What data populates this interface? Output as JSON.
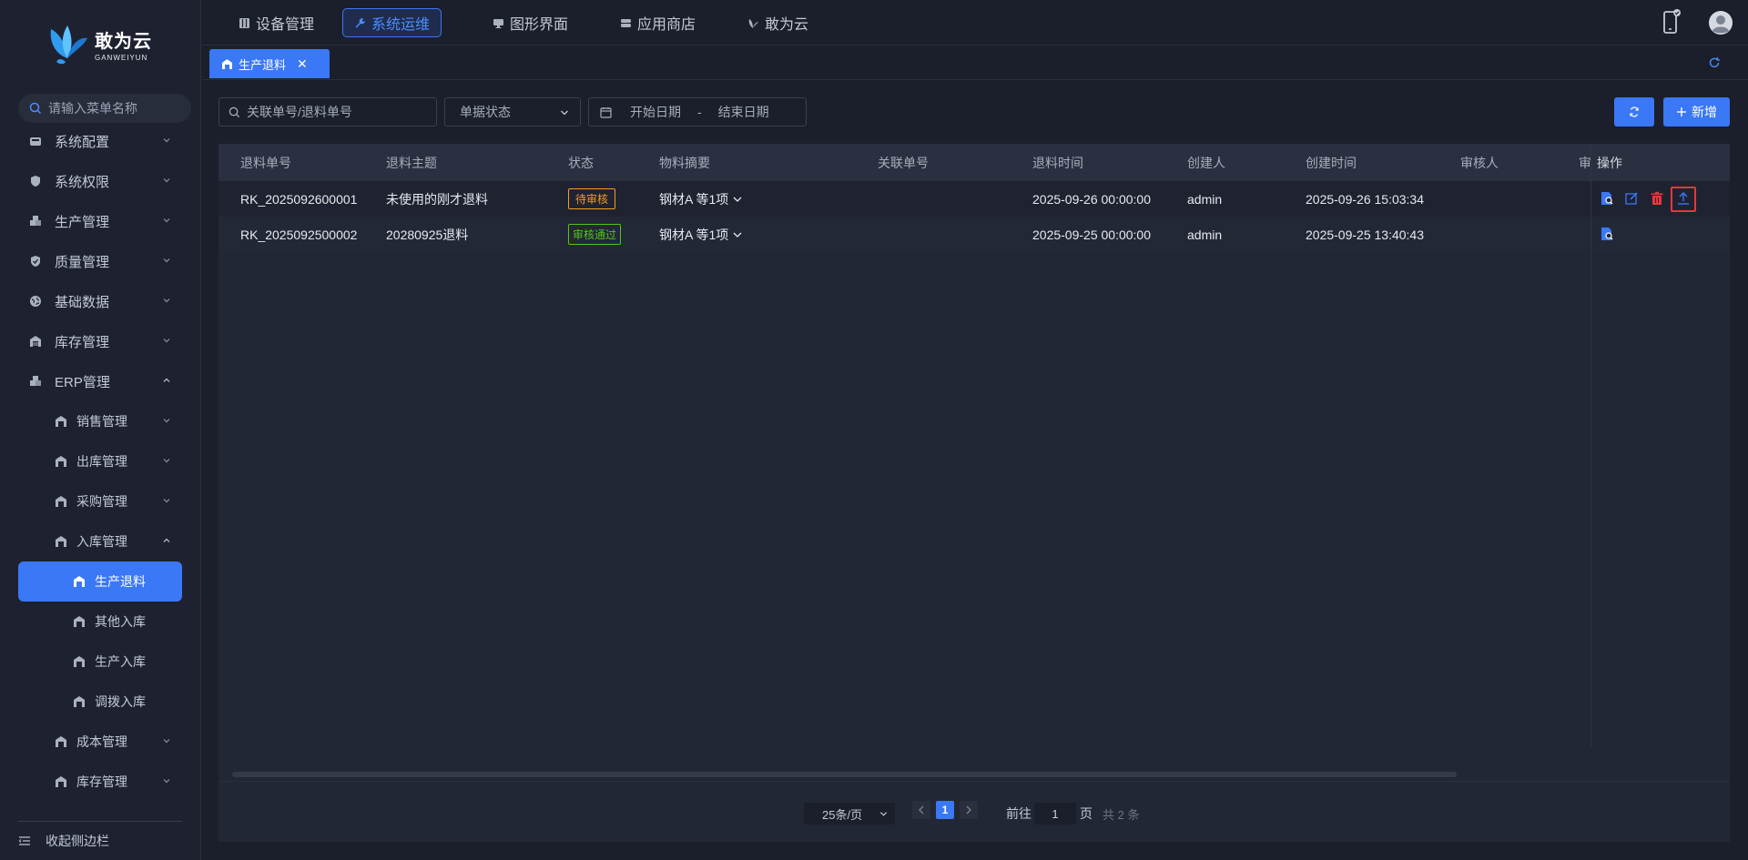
{
  "brand": {
    "name_cn": "敢为云",
    "name_en": "GANWEIYUN"
  },
  "sidebar": {
    "search_placeholder": "请输入菜单名称",
    "items": [
      {
        "label": "系统配置"
      },
      {
        "label": "系统权限"
      },
      {
        "label": "生产管理"
      },
      {
        "label": "质量管理"
      },
      {
        "label": "基础数据"
      },
      {
        "label": "库存管理"
      },
      {
        "label": "ERP管理"
      }
    ],
    "erp_children": [
      {
        "label": "销售管理"
      },
      {
        "label": "出库管理"
      },
      {
        "label": "采购管理"
      },
      {
        "label": "入库管理"
      },
      {
        "label": "成本管理"
      },
      {
        "label": "库存管理"
      }
    ],
    "inbound_children": [
      {
        "label": "生产退料",
        "active": true
      },
      {
        "label": "其他入库"
      },
      {
        "label": "生产入库"
      },
      {
        "label": "调拨入库"
      }
    ],
    "collapse_label": "收起侧边栏"
  },
  "topnav": {
    "tabs": [
      {
        "label": "设备管理",
        "icon": "device-icon"
      },
      {
        "label": "系统运维",
        "icon": "wrench-icon",
        "active": true
      },
      {
        "label": "图形界面",
        "icon": "monitor-icon"
      },
      {
        "label": "应用商店",
        "icon": "store-icon"
      },
      {
        "label": "敢为云",
        "icon": "cloud-logo-icon"
      }
    ]
  },
  "page_tab": {
    "label": "生产退料"
  },
  "filters": {
    "search_placeholder": "关联单号/退料单号",
    "status_placeholder": "单据状态",
    "start_date_placeholder": "开始日期",
    "date_separator": "-",
    "end_date_placeholder": "结束日期",
    "add_label": "新增"
  },
  "table": {
    "columns": [
      "退料单号",
      "退料主题",
      "状态",
      "物料摘要",
      "关联单号",
      "退料时间",
      "创建人",
      "创建时间",
      "审核人",
      "审",
      "操作"
    ],
    "rows": [
      {
        "code": "RK_2025092600001",
        "subject": "未使用的刚才退料",
        "status": "待审核",
        "summary": "钢材A 等1项",
        "related": "",
        "return_time": "2025-09-26 00:00:00",
        "creator": "admin",
        "created_at": "2025-09-26 15:03:34",
        "auditor": ""
      },
      {
        "code": "RK_2025092500002",
        "subject": "20280925退料",
        "status": "审核通过",
        "summary": "钢材A 等1项",
        "related": "",
        "return_time": "2025-09-25 00:00:00",
        "creator": "admin",
        "created_at": "2025-09-25 13:40:43",
        "auditor": ""
      }
    ]
  },
  "pagination": {
    "page_size_label": "25条/页",
    "current_page": "1",
    "goto_label": "前往",
    "goto_value": "1",
    "page_unit": "页",
    "total_label": "共 2 条"
  },
  "colors": {
    "accent": "#3a78f5",
    "pending": "#f59a23",
    "approved": "#52c41a",
    "danger": "#e5383b"
  }
}
